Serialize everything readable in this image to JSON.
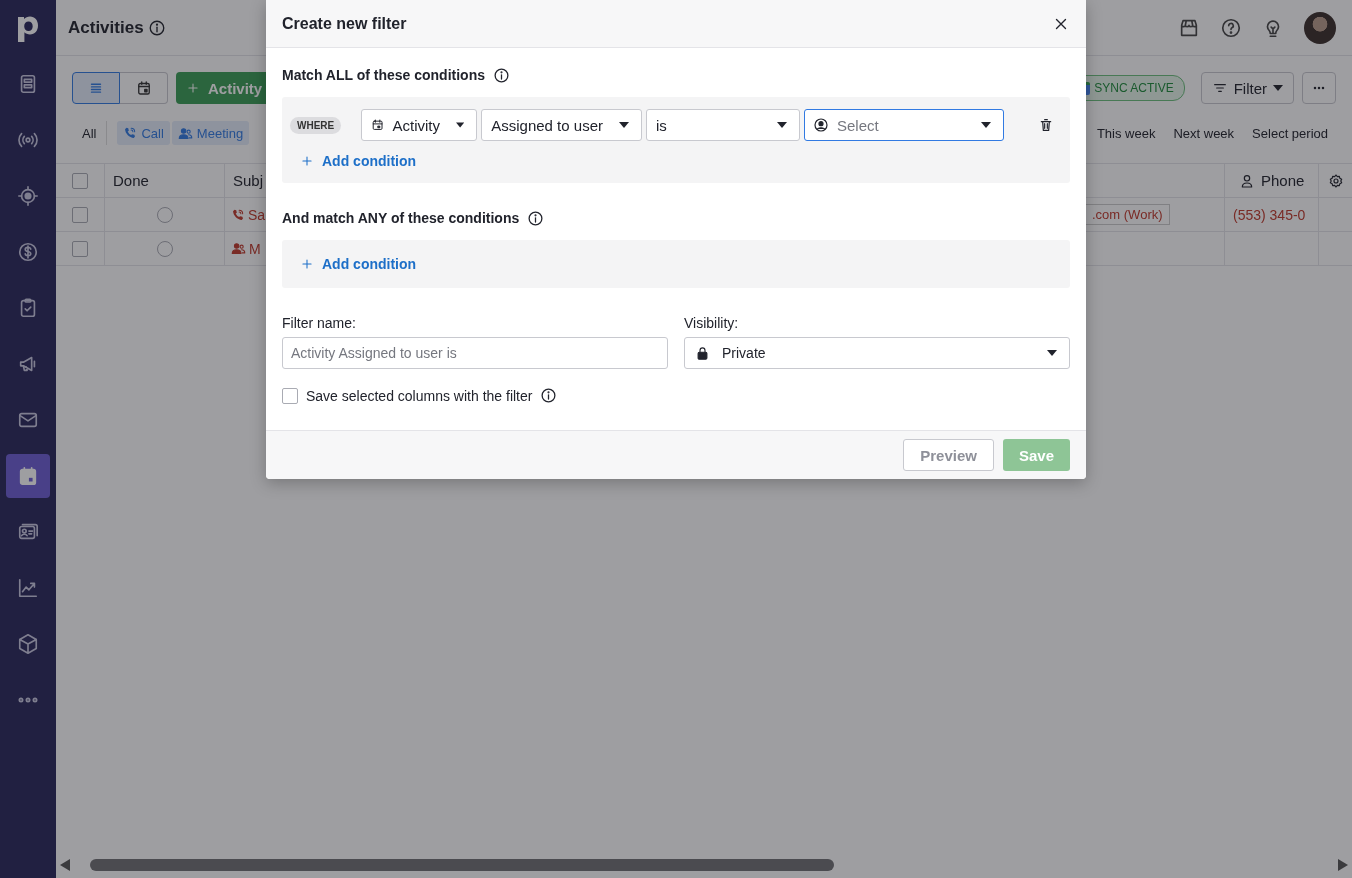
{
  "sidebar": {
    "items": [
      {
        "kind": "leads",
        "selected": false
      },
      {
        "kind": "campaigns",
        "selected": false
      },
      {
        "kind": "target",
        "selected": false
      },
      {
        "kind": "deals",
        "selected": false
      },
      {
        "kind": "tasks",
        "selected": false
      },
      {
        "kind": "megaphone",
        "selected": false
      },
      {
        "kind": "mail",
        "selected": false
      },
      {
        "kind": "calendar",
        "selected": true
      },
      {
        "kind": "contacts",
        "selected": false
      },
      {
        "kind": "insights",
        "selected": false
      },
      {
        "kind": "products",
        "selected": false
      },
      {
        "kind": "more",
        "selected": false
      }
    ]
  },
  "header": {
    "title": "Activities"
  },
  "toolbar": {
    "view_toggle": [
      {
        "kind": "list",
        "selected": true
      },
      {
        "kind": "calendar",
        "selected": false
      }
    ],
    "add_button": "Activity",
    "type_filters": [
      {
        "label": "All",
        "kind": "all"
      },
      {
        "label": "Call",
        "kind": "call"
      },
      {
        "label": "Meeting",
        "kind": "meeting"
      }
    ],
    "sync_badge": "SYNC ACTIVE",
    "filter_button": "Filter",
    "period_filters": [
      "This week",
      "Next week",
      "Select period"
    ]
  },
  "table": {
    "all_checked": false,
    "columns": [
      {
        "label": "Done"
      },
      {
        "label": "Subj"
      },
      {
        "label": "Phone"
      }
    ],
    "rows": [
      {
        "checked": false,
        "done": false,
        "kind": "call",
        "subject": "Sa",
        "email": ".com (Work)",
        "phone": "(553) 345-0"
      },
      {
        "checked": false,
        "done": false,
        "kind": "meeting",
        "subject": "M"
      }
    ]
  },
  "dialog": {
    "title": "Create new filter",
    "match_all": {
      "heading": "Match ALL of these conditions",
      "conditions": [
        {
          "where_label": "WHERE",
          "fields": [
            {
              "kind": "entity",
              "value": "Activity"
            },
            {
              "kind": "plain",
              "value": "Assigned to user"
            },
            {
              "kind": "plain",
              "value": "is"
            },
            {
              "kind": "user",
              "placeholder": "Select",
              "focused": true
            }
          ]
        }
      ],
      "add_condition": "Add condition"
    },
    "match_any": {
      "heading": "And match ANY of these conditions",
      "add_condition": "Add condition"
    },
    "filter_name": {
      "label": "Filter name:",
      "placeholder": "Activity Assigned to user is"
    },
    "visibility": {
      "label": "Visibility:",
      "value": "Private"
    },
    "save_columns": {
      "label": "Save selected columns with the filter",
      "checked": false
    },
    "buttons": [
      {
        "label": "Preview",
        "kind": "secondary",
        "disabled": true
      },
      {
        "label": "Save",
        "kind": "primary",
        "disabled": true
      }
    ]
  }
}
